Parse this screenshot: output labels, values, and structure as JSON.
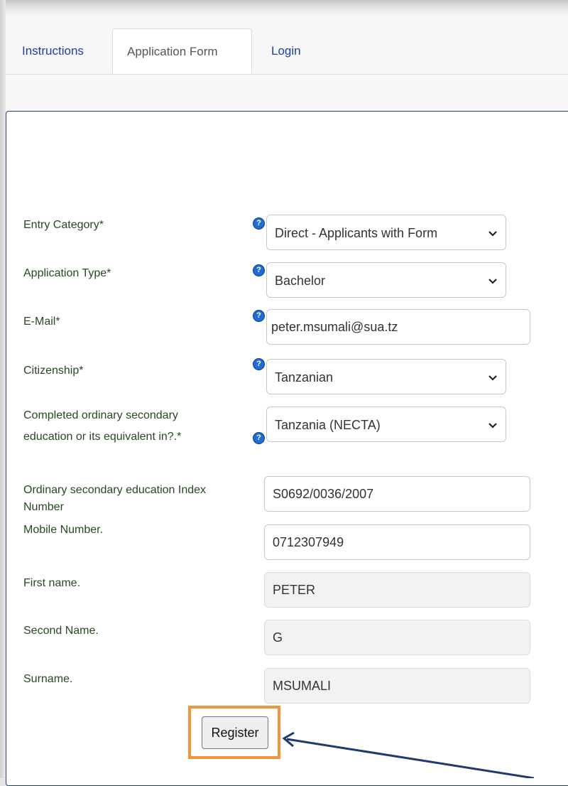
{
  "tabs": [
    {
      "label": "Instructions",
      "active": false
    },
    {
      "label": "Application Form",
      "active": true
    },
    {
      "label": "Login",
      "active": false
    }
  ],
  "help_icon_glyph": "?",
  "form": {
    "entry_category": {
      "label": "Entry Category*",
      "value": "Direct - Applicants with Form"
    },
    "application_type": {
      "label": "Application Type*",
      "value": "Bachelor"
    },
    "email": {
      "label": "E-Mail*",
      "value": "peter.msumali@sua.tz"
    },
    "citizenship": {
      "label": "Citizenship*",
      "value": "Tanzanian"
    },
    "secondary_education": {
      "label_line1": "Completed ordinary secondary",
      "label_line2": "education or its equivalent in?.*",
      "value": "Tanzania (NECTA)"
    },
    "index_number": {
      "label_line1": "Ordinary secondary education Index",
      "label_line2": "Number",
      "value": "S0692/0036/2007"
    },
    "mobile": {
      "label": "Mobile Number.",
      "value": "0712307949"
    },
    "first_name": {
      "label": "First name.",
      "value": "PETER"
    },
    "second_name": {
      "label": "Second Name.",
      "value": "G"
    },
    "surname": {
      "label": "Surname.",
      "value": "MSUMALI"
    },
    "register_label": "Register"
  },
  "colors": {
    "highlight": "#f2943a",
    "arrow": "#1f3a6e",
    "link": "#1d3f9e",
    "label": "#264a20",
    "help_icon": "#1f6ed4"
  }
}
